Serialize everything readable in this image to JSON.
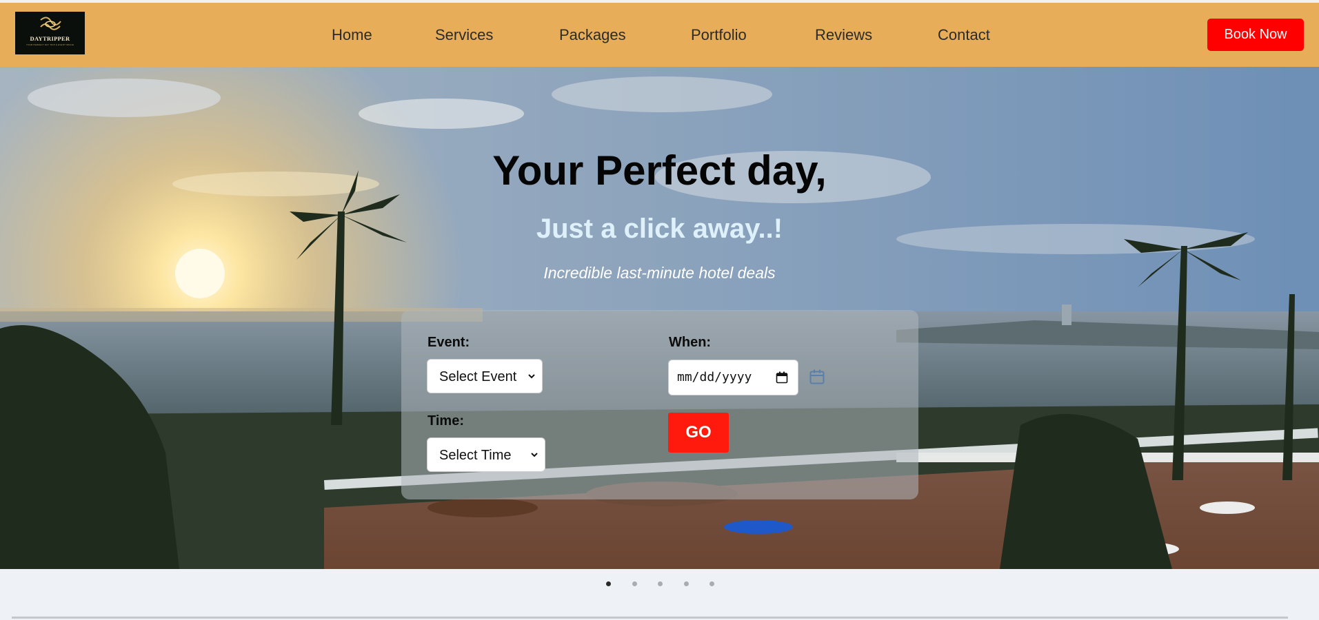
{
  "header": {
    "logo": {
      "name": "DAYTRIPPER",
      "tagline": "YOUR PERFECT DAY TRIP & EVENT SPACE"
    },
    "nav": [
      "Home",
      "Services",
      "Packages",
      "Portfolio",
      "Reviews",
      "Contact"
    ],
    "book_label": "Book Now",
    "colors": {
      "bar": "#e8ad58",
      "book_button": "#ff0000"
    }
  },
  "hero": {
    "title": "Your Perfect day,",
    "subtitle": "Just a click away..!",
    "tagline": "Incredible last-minute hotel deals"
  },
  "search": {
    "event_label": "Event:",
    "event_value": "Select Event",
    "time_label": "Time:",
    "time_value": "Select Time",
    "when_label": "When:",
    "date_placeholder": "mm/dd/yyyy",
    "go_label": "GO",
    "colors": {
      "go_button": "#ff1a0d"
    }
  },
  "carousel": {
    "count": 5,
    "active_index": 0
  }
}
